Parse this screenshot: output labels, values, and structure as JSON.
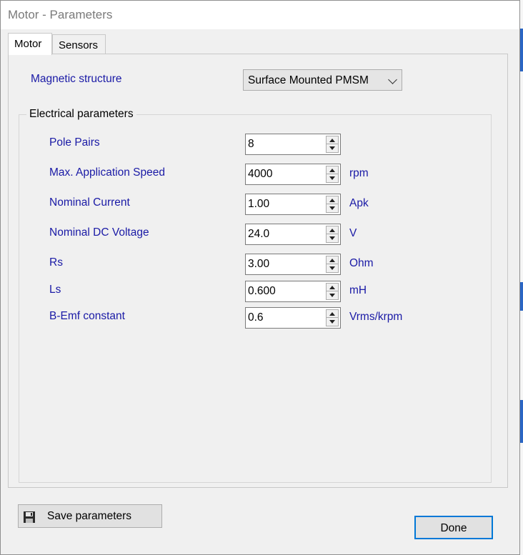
{
  "window": {
    "title": "Motor - Parameters"
  },
  "tabs": [
    {
      "label": "Motor",
      "active": true
    },
    {
      "label": "Sensors",
      "active": false
    }
  ],
  "magnetic_structure": {
    "label": "Magnetic structure",
    "value": "Surface Mounted PMSM"
  },
  "electrical": {
    "title": "Electrical parameters",
    "params": [
      {
        "label": "Pole Pairs",
        "value": "8",
        "unit": ""
      },
      {
        "label": "Max. Application Speed",
        "value": "4000",
        "unit": "rpm"
      },
      {
        "label": "Nominal Current",
        "value": "1.00",
        "unit": "Apk"
      },
      {
        "label": "Nominal DC Voltage",
        "value": "24.0",
        "unit": "V"
      },
      {
        "label": "Rs",
        "value": "3.00",
        "unit": "Ohm"
      },
      {
        "label": "Ls",
        "value": "0.600",
        "unit": "mH"
      },
      {
        "label": "B-Emf constant",
        "value": "0.6",
        "unit": "Vrms/krpm"
      }
    ]
  },
  "buttons": {
    "save": "Save parameters",
    "done": "Done"
  },
  "colors": {
    "label_blue": "#1a1aa6",
    "focus_border": "#0078d7"
  }
}
